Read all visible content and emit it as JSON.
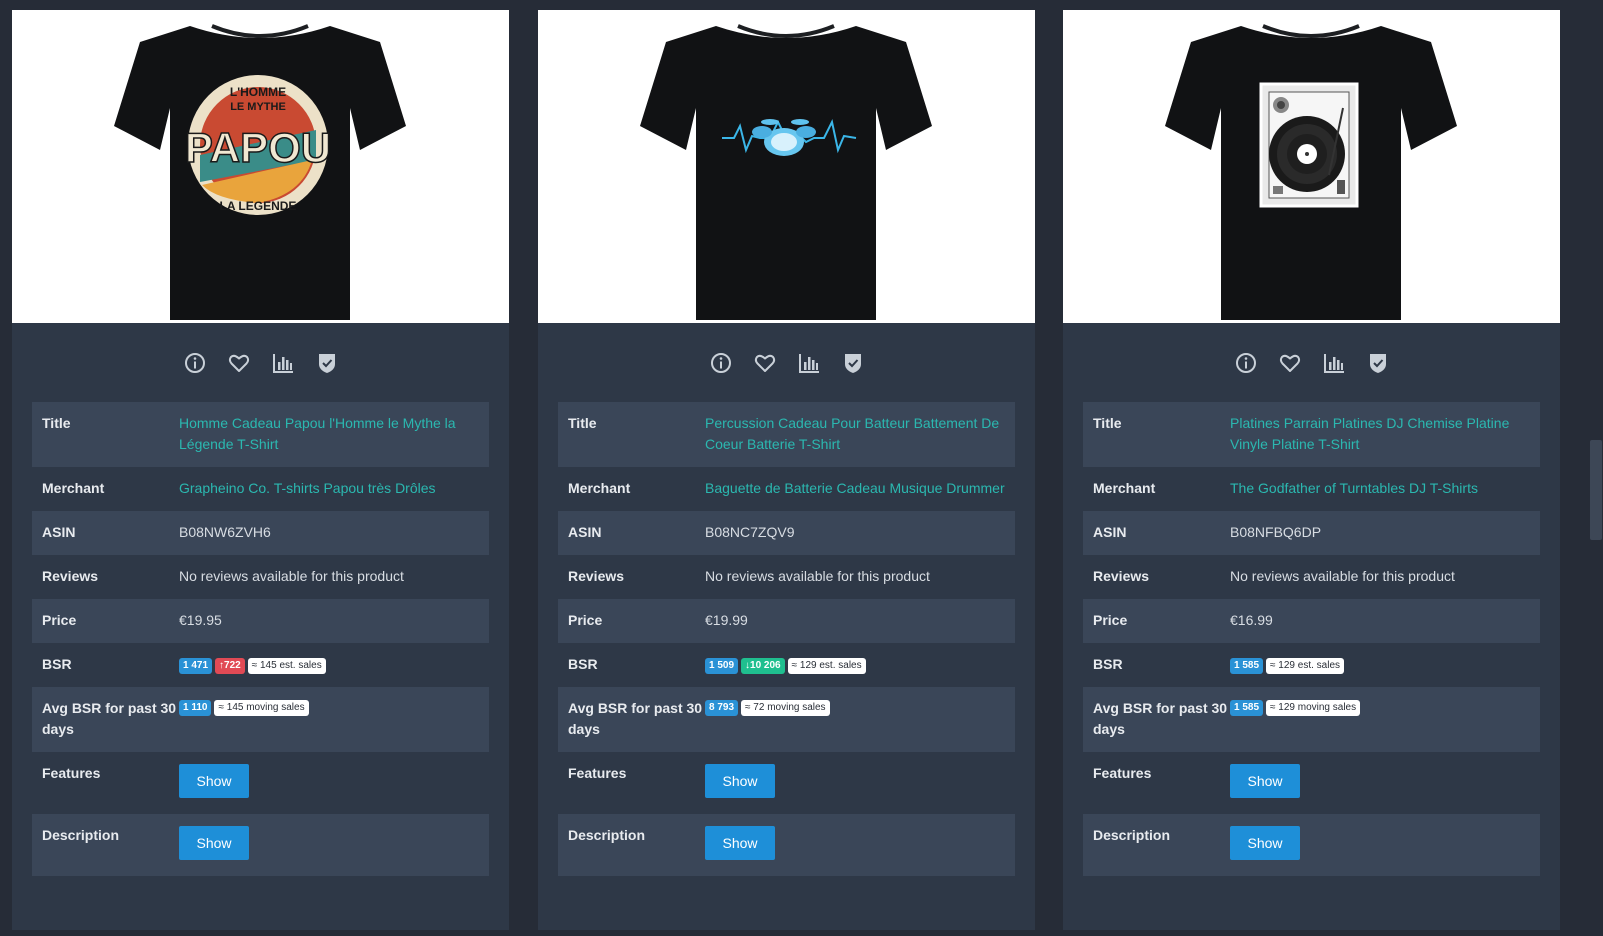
{
  "labels": {
    "title": "Title",
    "merchant": "Merchant",
    "asin": "ASIN",
    "reviews": "Reviews",
    "price": "Price",
    "bsr": "BSR",
    "avg_bsr": "Avg BSR for past 30 days",
    "features": "Features",
    "description": "Description"
  },
  "icons": [
    "info-circle-icon",
    "heart-icon",
    "bar-chart-icon",
    "shield-check-icon"
  ],
  "colors": {
    "link": "#2bb8b0",
    "button": "#1e8fd8",
    "badge_blue": "#2a92d6",
    "badge_red": "#e14a55",
    "badge_green": "#1fbf8f"
  },
  "products": [
    {
      "image": "t-shirt-papou-print",
      "print_text": [
        "L'HOMME",
        "LE MYTHE",
        "PAPOU",
        "LA LEGENDE"
      ],
      "title": "Homme Cadeau Papou l'Homme le Mythe la Légende T-Shirt",
      "merchant": "Grapheino Co. T-shirts Papou très Drôles",
      "asin": "B08NW6ZVH6",
      "reviews": "No reviews available for this product",
      "price": "€19.95",
      "bsr": "1 471",
      "bsr_change": "722",
      "bsr_change_dir": "up",
      "bsr_sales": "≈ 145 est. sales",
      "avg_bsr": "1 110",
      "avg_sales": "≈ 145 moving sales",
      "features_btn": "Show",
      "description_btn": "Show"
    },
    {
      "image": "t-shirt-drum-heartbeat-print",
      "title": "Percussion Cadeau Pour Batteur Battement De Coeur Batterie T-Shirt",
      "merchant": "Baguette de Batterie Cadeau Musique Drummer",
      "asin": "B08NC7ZQV9",
      "reviews": "No reviews available for this product",
      "price": "€19.99",
      "bsr": "1 509",
      "bsr_change": "10 206",
      "bsr_change_dir": "down",
      "bsr_sales": "≈ 129 est. sales",
      "avg_bsr": "8 793",
      "avg_sales": "≈ 72 moving sales",
      "features_btn": "Show",
      "description_btn": "Show"
    },
    {
      "image": "t-shirt-turntable-print",
      "title": "Platines Parrain Platines DJ Chemise Platine Vinyle Platine T-Shirt",
      "merchant": "The Godfather of Turntables DJ T-Shirts",
      "asin": "B08NFBQ6DP",
      "reviews": "No reviews available for this product",
      "price": "€16.99",
      "bsr": "1 585",
      "bsr_sales": "≈ 129 est. sales",
      "avg_bsr": "1 585",
      "avg_sales": "≈ 129 moving sales",
      "features_btn": "Show",
      "description_btn": "Show"
    }
  ]
}
